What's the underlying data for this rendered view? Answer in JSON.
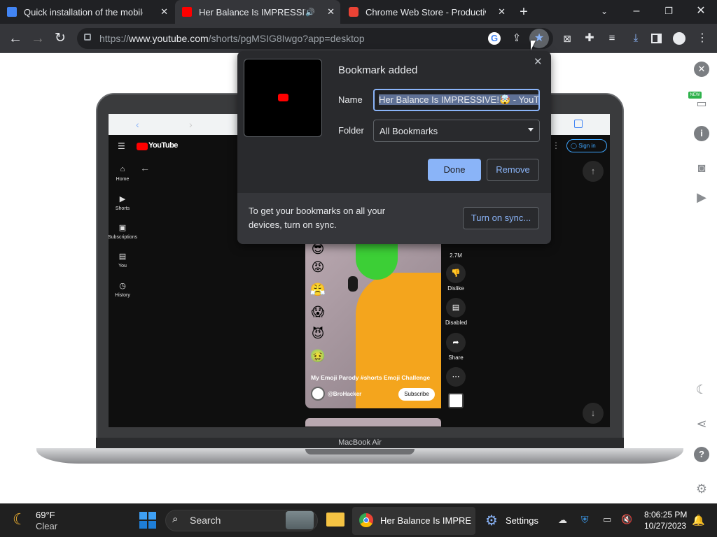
{
  "browser": {
    "tabs": [
      {
        "title": "Quick installation of the mobile",
        "favicon_color": "#4285f4"
      },
      {
        "title": "Her Balance Is IMPRESSIVE!",
        "favicon_color": "#ff0000",
        "active": true
      },
      {
        "title": "Chrome Web Store - Productivity",
        "favicon_color": "#ea4335"
      }
    ],
    "new_tab": "+",
    "url_prefix": "https://",
    "url_host": "www.youtube.com",
    "url_path": "/shorts/pgMSIG8Iwgo?app=desktop"
  },
  "bookmark_dialog": {
    "title": "Bookmark added",
    "name_label": "Name",
    "name_value": "Her Balance Is IMPRESSIVE!🤯 - YouTube",
    "folder_label": "Folder",
    "folder_value": "All Bookmarks",
    "done_label": "Done",
    "remove_label": "Remove",
    "sync_text_line1": "To get your bookmarks on all your",
    "sync_text_line2": "devices, turn on sync.",
    "sync_button": "Turn on sync..."
  },
  "youtube": {
    "logo_text": "YouTube",
    "sign_in": "Sign in",
    "sidebar": [
      {
        "icon": "home-icon",
        "label": "Home"
      },
      {
        "icon": "shorts-icon",
        "label": "Shorts"
      },
      {
        "icon": "subscriptions-icon",
        "label": "Subscriptions"
      },
      {
        "icon": "library-icon",
        "label": "You"
      },
      {
        "icon": "history-icon",
        "label": "History"
      }
    ],
    "short_title": "My Emoji Parody #shorts Emoji Challenge",
    "channel": "@BroHacker",
    "subscribe": "Subscribe",
    "likes": "2.7M",
    "dislike": "Dislike",
    "comments": "Disabled",
    "share": "Share",
    "emojis": [
      "😎",
      "😡",
      "😤",
      "😱",
      "😈",
      "🤢"
    ]
  },
  "laptop_label": "MacBook Air",
  "taskbar": {
    "weather_temp": "69°F",
    "weather_cond": "Clear",
    "search_placeholder": "Search",
    "chrome_window": "Her Balance Is IMPRESSI",
    "settings_window": "Settings",
    "time": "8:06:25 PM",
    "date": "10/27/2023"
  },
  "right_rail_badge": "NEW"
}
